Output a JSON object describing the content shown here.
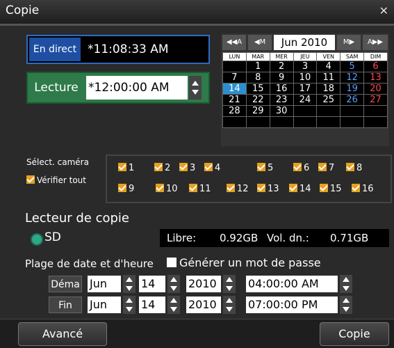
{
  "window": {
    "title": "Copie",
    "close_icon": "close-icon"
  },
  "live": {
    "label": "En direct",
    "time": "*11:08:33 AM"
  },
  "playback": {
    "label": "Lecture",
    "time": "*12:00:00 AM"
  },
  "calendar": {
    "nav_prev_year": "◀◀A",
    "nav_prev_month": "◀M",
    "month": "Jun 2010",
    "nav_next_month": "M▶",
    "nav_next_year": "A▶▶",
    "day_headers": [
      "LUN",
      "MAR",
      "MER",
      "JEU",
      "VEN",
      "SAM",
      "DIM"
    ],
    "weeks": [
      [
        "",
        "1",
        "2",
        "3",
        "4",
        "5",
        "6"
      ],
      [
        "7",
        "8",
        "9",
        "10",
        "11",
        "12",
        "13"
      ],
      [
        "14",
        "15",
        "16",
        "17",
        "18",
        "19",
        "20"
      ],
      [
        "21",
        "22",
        "23",
        "24",
        "25",
        "26",
        "27"
      ],
      [
        "28",
        "29",
        "30",
        "",
        "",
        "",
        ""
      ],
      [
        "",
        "",
        "",
        "",
        "",
        "",
        ""
      ]
    ],
    "today": "14"
  },
  "cameras": {
    "label": "Sélect. caméra",
    "check_all": "Vérifier tout",
    "items": [
      "1",
      "2",
      "3",
      "4",
      "5",
      "6",
      "7",
      "8",
      "9",
      "10",
      "11",
      "12",
      "13",
      "14",
      "15",
      "16"
    ]
  },
  "copy_drive": {
    "label": "Lecteur de copie",
    "sd": "SD",
    "free_label": "Libre:",
    "free_value": "0.92GB",
    "vol_label": "Vol. dn.:",
    "vol_value": "0.71GB"
  },
  "range": {
    "label": "Plage de date et d'heure",
    "password_label": "Générer un mot de passe",
    "start": {
      "button": "Déma",
      "month": "Jun",
      "day": "14",
      "year": "2010",
      "time": "04:00:00 AM"
    },
    "end": {
      "button": "Fin",
      "month": "Jun",
      "day": "14",
      "year": "2010",
      "time": "07:00:00 PM"
    }
  },
  "buttons": {
    "advanced": "Avancé",
    "copy": "Copie"
  },
  "colors": {
    "accent_blue": "#1e4fa3",
    "accent_green": "#2e7a4a",
    "checkbox": "#e8a020",
    "today": "#2a8fd0"
  }
}
